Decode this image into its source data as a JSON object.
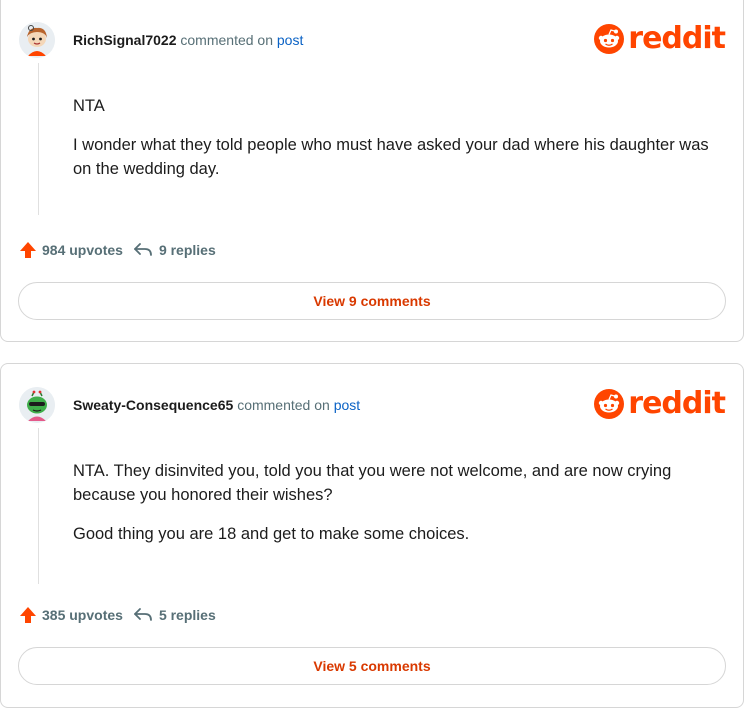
{
  "comments": [
    {
      "username": "RichSignal7022",
      "commented_on": "commented on",
      "post_link": "post",
      "logo_text": "reddit",
      "paragraphs": [
        "NTA",
        "I wonder what they told people who must have asked your dad where his daughter was on the wedding day."
      ],
      "upvotes": "984 upvotes",
      "replies": "9 replies",
      "view_label": "View 9 comments"
    },
    {
      "username": "Sweaty-Consequence65",
      "commented_on": "commented on",
      "post_link": "post",
      "logo_text": "reddit",
      "paragraphs": [
        "NTA. They disinvited you, told you that you were not welcome, and are now crying because you honored their wishes?",
        "Good thing you are 18 and get to make some choices."
      ],
      "upvotes": "385 upvotes",
      "replies": "5 replies",
      "view_label": "View 5 comments"
    }
  ],
  "icons": {
    "upvote": "upvote-arrow-icon",
    "reply": "reply-arrow-icon",
    "logo": "reddit-snoo-icon"
  },
  "colors": {
    "brand": "#ff4500",
    "link": "#0a62c5",
    "muted": "#576f76",
    "button_text": "#d93900"
  }
}
